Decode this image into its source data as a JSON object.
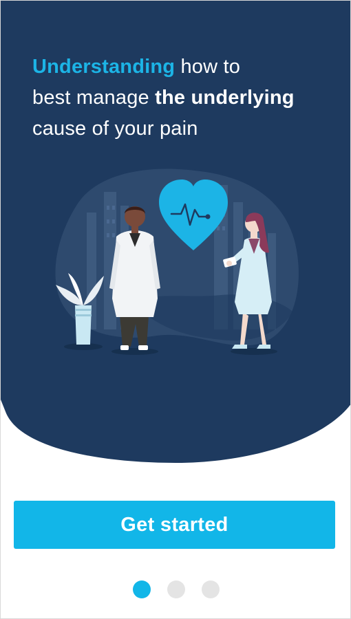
{
  "onboarding": {
    "headline": {
      "accent": "Understanding",
      "part1": " how to",
      "part2": "best manage ",
      "strong": "the underlying",
      "part3": "cause of your pain"
    },
    "cta_label": "Get started",
    "pager": {
      "total": 3,
      "current": 1
    }
  },
  "colors": {
    "hero_background": "#1e3a5f",
    "accent": "#12b6e8",
    "dot_inactive": "#e4e4e4",
    "text_on_dark": "#ffffff"
  },
  "icons": [
    "heart-pulse-icon",
    "doctor-male-illustration",
    "doctor-female-illustration",
    "potted-plant-illustration",
    "city-skyline-illustration"
  ]
}
